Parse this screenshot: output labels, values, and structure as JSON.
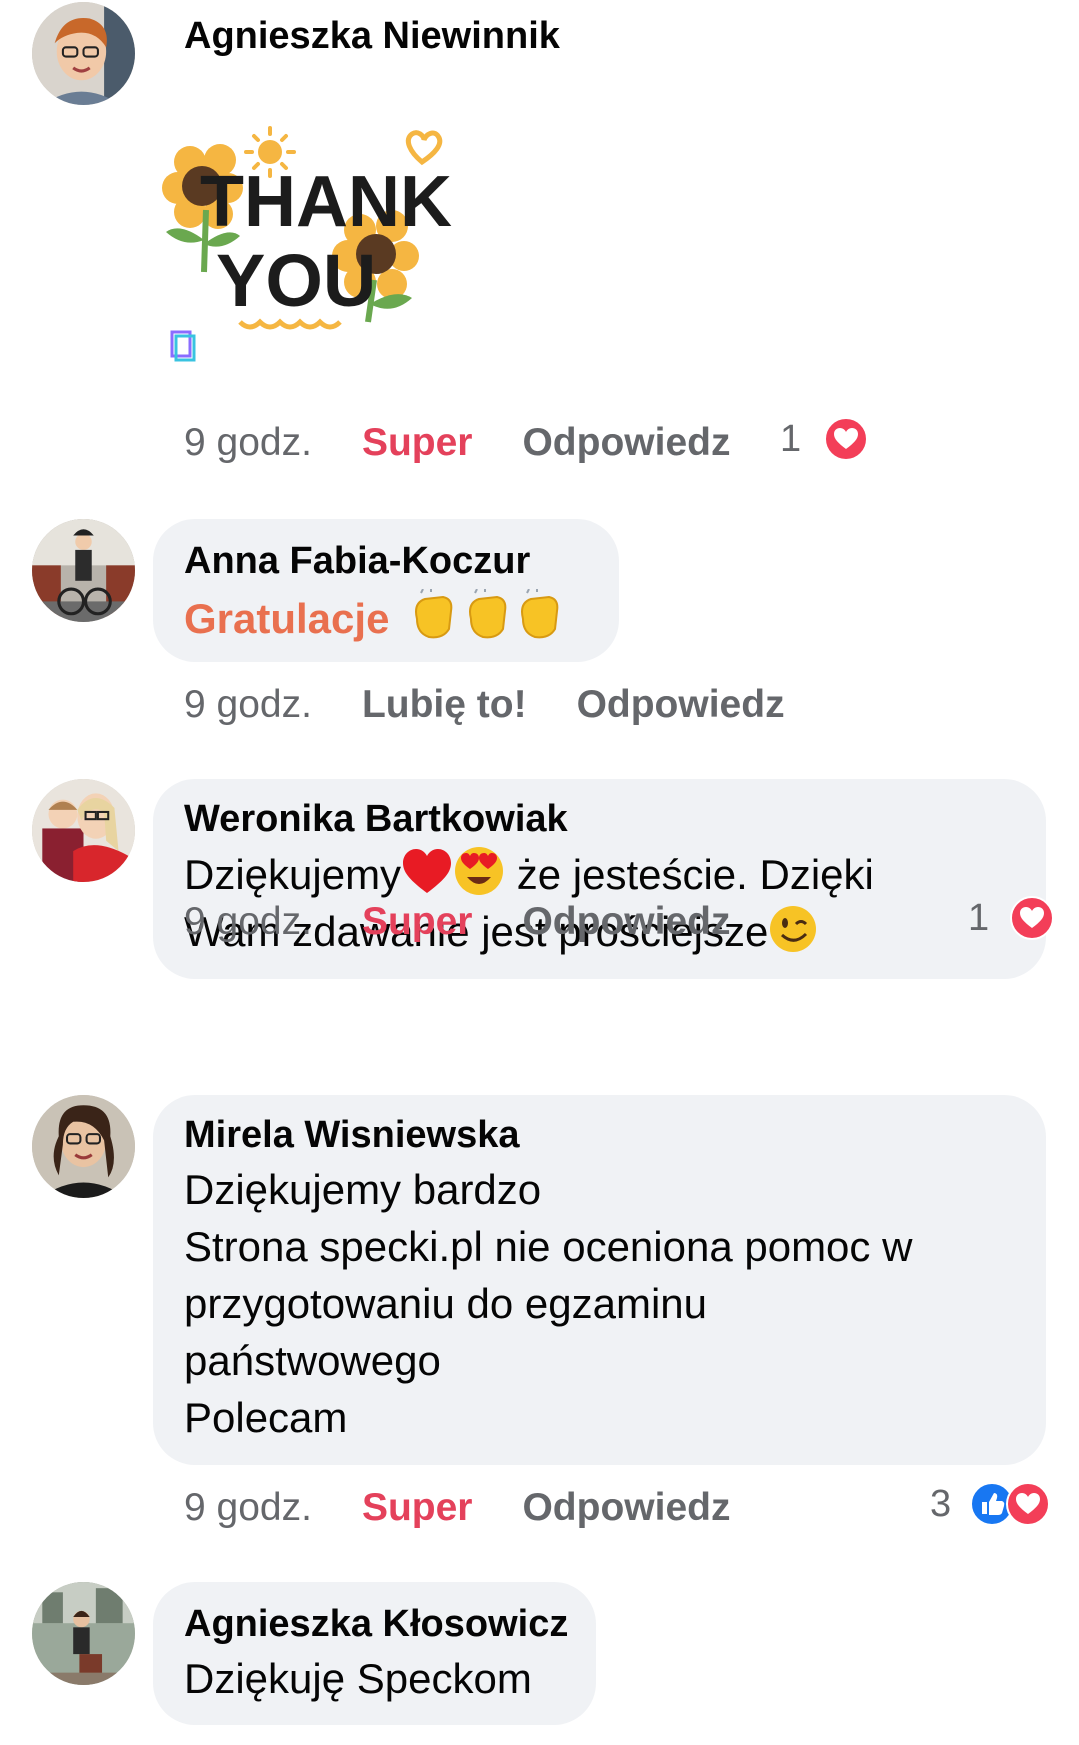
{
  "comments": [
    {
      "author": "Agnieszka Niewinnik",
      "sticker_text_1": "THANK",
      "sticker_text_2": "YOU",
      "time": "9 godz.",
      "reaction_label": "Super",
      "reply_label": "Odpowiedz",
      "reaction_count": "1"
    },
    {
      "author": "Anna Fabia-Koczur",
      "text": "Gratulacje",
      "time": "9 godz.",
      "reaction_label": "Lubię to!",
      "reply_label": "Odpowiedz"
    },
    {
      "author": "Weronika Bartkowiak",
      "text_part1": "Dziękujemy",
      "text_part2": " że jesteście. Dzięki",
      "text_part3": "Wam zdawanie jest prościejsze",
      "time": "9 godz.",
      "reaction_label": "Super",
      "reply_label": "Odpowiedz",
      "reaction_count": "1"
    },
    {
      "author": "Mirela Wisniewska",
      "text": "Dziękujemy bardzo\nStrona specki.pl nie oceniona pomoc w\nprzygotowaniu do egzaminu\npaństwowego\nPolecam",
      "time": "9 godz.",
      "reaction_label": "Super",
      "reply_label": "Odpowiedz",
      "reaction_count": "3"
    },
    {
      "author": "Agnieszka Kłosowicz",
      "text": "Dziękuję Speckom"
    }
  ],
  "colors": {
    "bubble": "#f0f2f5",
    "meta": "#65676b",
    "super": "#e4415b",
    "gratulacje": "#e9704f",
    "like_blue": "#1877f2",
    "love_red": "#f33e58"
  },
  "icons": [
    "thank-you-sticker",
    "clapping-hands-emoji",
    "red-heart-emoji",
    "heart-eyes-emoji",
    "winking-face-emoji",
    "love-reaction-icon",
    "like-reaction-icon"
  ]
}
